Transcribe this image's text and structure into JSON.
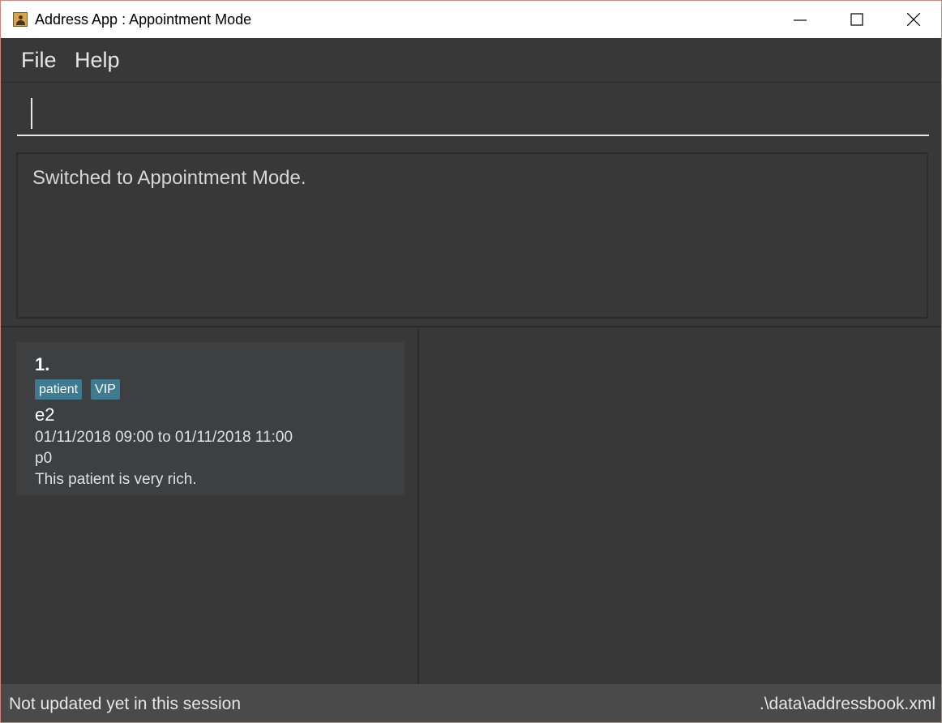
{
  "window": {
    "title": "Address App : Appointment Mode"
  },
  "menu": {
    "items": [
      {
        "label": "File"
      },
      {
        "label": "Help"
      }
    ]
  },
  "command": {
    "value": "",
    "placeholder": ""
  },
  "result": {
    "message": "Switched to Appointment Mode."
  },
  "appointments": [
    {
      "index": "1.",
      "tags": [
        "patient",
        "VIP"
      ],
      "title": "e2",
      "time": "01/11/2018 09:00 to 01/11/2018 11:00",
      "patient": "p0",
      "note": "This patient is very rich."
    }
  ],
  "status": {
    "sync": "Not updated yet in this session",
    "file": ".\\data\\addressbook.xml"
  },
  "colors": {
    "background": "#383838",
    "card": "#3d3f40",
    "tag": "#3e7b91",
    "statusbar": "#4a4a4a"
  },
  "icons": {
    "app": "address-book-icon",
    "minimize": "minimize-icon",
    "maximize": "maximize-icon",
    "close": "close-icon"
  }
}
